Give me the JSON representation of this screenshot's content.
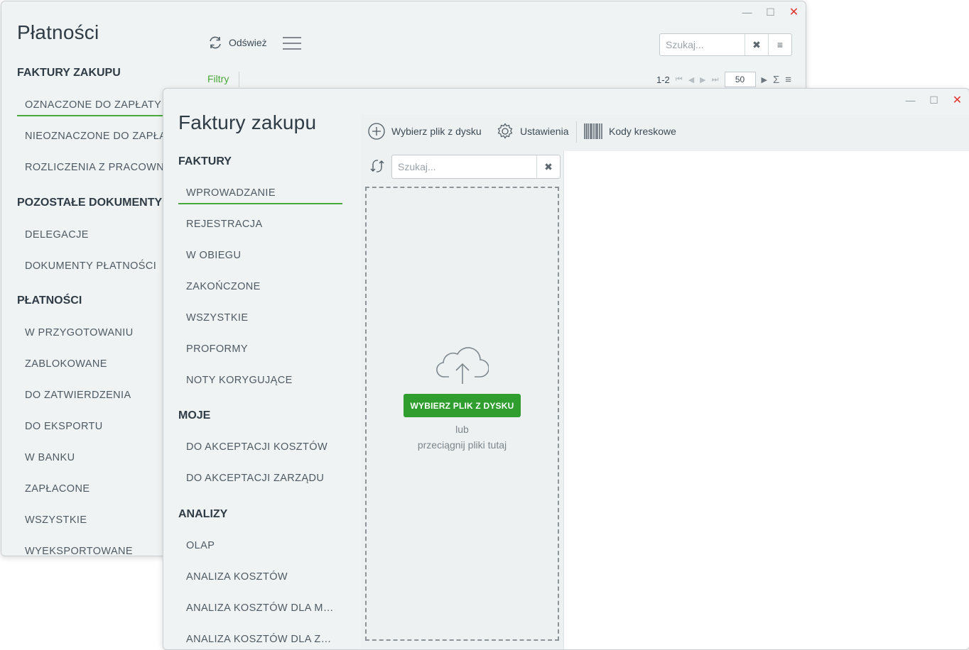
{
  "back_window": {
    "title": "Płatności",
    "toolbar": {
      "refresh_label": "Odśwież"
    },
    "search": {
      "placeholder": "Szukaj..."
    },
    "filters_label": "Filtry",
    "pager": {
      "range": "1-2",
      "page_size": "50"
    },
    "sections": [
      {
        "label": "FAKTURY ZAKUPU",
        "items": [
          "OZNACZONE DO ZAPŁATY",
          "NIEOZNACZONE DO ZAPŁA",
          "ROZLICZENIA Z PRACOWNI"
        ]
      },
      {
        "label": "POZOSTAŁE DOKUMENTY",
        "items": [
          "DELEGACJE",
          "DOKUMENTY PŁATNOŚCI"
        ]
      },
      {
        "label": "PŁATNOŚCI",
        "items": [
          "W PRZYGOTOWANIU",
          "ZABLOKOWANE",
          "DO ZATWIERDZENIA",
          "DO EKSPORTU",
          "W BANKU",
          "ZAPŁACONE",
          "WSZYSTKIE",
          "WYEKSPORTOWANE"
        ]
      }
    ]
  },
  "front_window": {
    "title": "Faktury zakupu",
    "toolbar": {
      "choose_file_label": "Wybierz plik z dysku",
      "settings_label": "Ustawienia",
      "barcodes_label": "Kody kreskowe"
    },
    "search": {
      "placeholder": "Szukaj..."
    },
    "dropzone": {
      "button_label": "WYBIERZ PLIK Z DYSKU",
      "or_text": "lub",
      "drag_text": "przeciągnij pliki tutaj"
    },
    "sections": [
      {
        "label": "FAKTURY",
        "items": [
          "WPROWADZANIE",
          "REJESTRACJA",
          "W OBIEGU",
          "ZAKOŃCZONE",
          "WSZYSTKIE",
          "PROFORMY",
          "NOTY KORYGUJĄCE"
        ]
      },
      {
        "label": "MOJE",
        "items": [
          "DO AKCEPTACJI KOSZTÓW",
          "DO AKCEPTACJI ZARZĄDU"
        ]
      },
      {
        "label": "ANALIZY",
        "items": [
          "OLAP",
          "ANALIZA KOSZTÓW",
          "ANALIZA KOSZTÓW DLA M…",
          "ANALIZA KOSZTÓW DLA Z…"
        ]
      }
    ]
  },
  "colors": {
    "accent": "#49a83c",
    "button": "#2f9e2f",
    "close": "#e0322e"
  }
}
